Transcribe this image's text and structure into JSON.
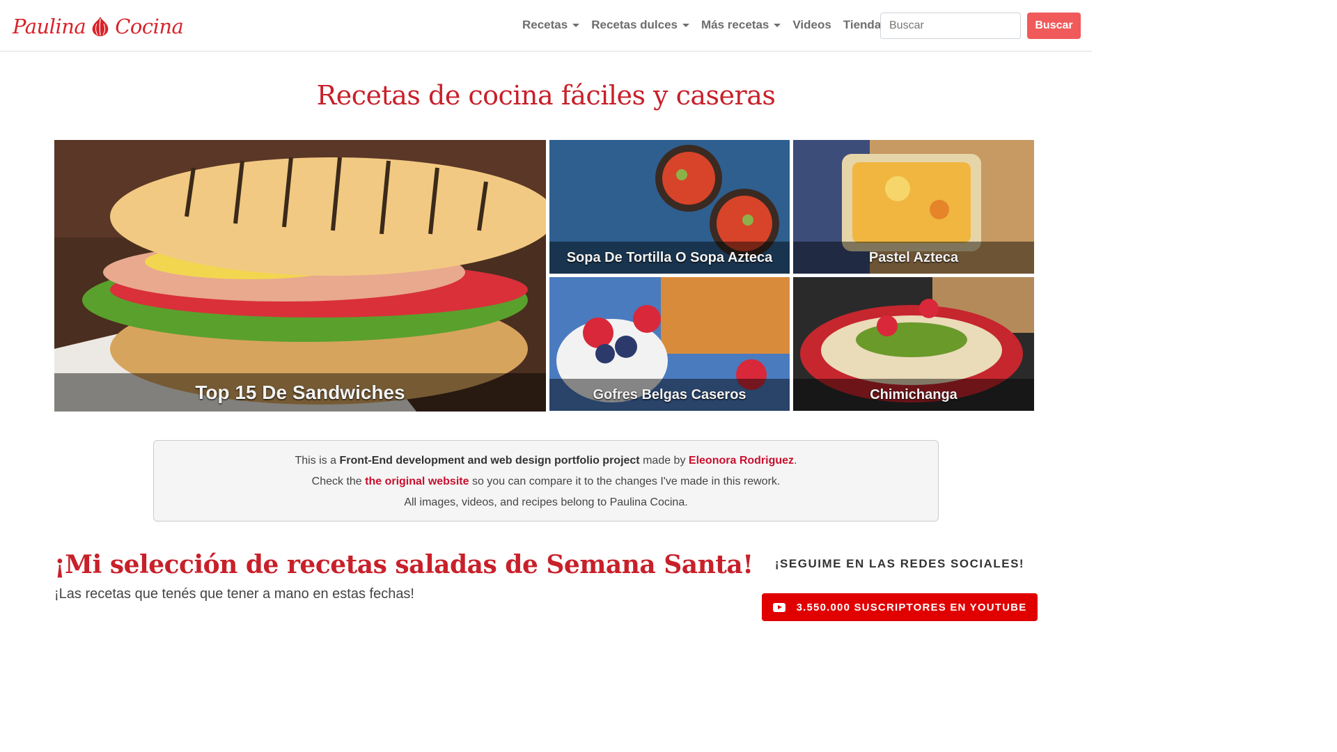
{
  "brand": {
    "logo_left": "Paulina",
    "logo_right": "Cocina"
  },
  "nav": {
    "items": [
      {
        "label": "Recetas",
        "dropdown": true
      },
      {
        "label": "Recetas dulces",
        "dropdown": true
      },
      {
        "label": "Más recetas",
        "dropdown": true
      },
      {
        "label": "Videos",
        "dropdown": false
      },
      {
        "label": "Tienda",
        "dropdown": true
      }
    ],
    "search_placeholder": "Buscar",
    "search_button": "Buscar"
  },
  "hero_title": "Recetas de cocina fáciles y caseras",
  "featured": [
    {
      "caption": "Top 15 De Sandwiches"
    },
    {
      "caption": "Sopa De Tortilla O Sopa Azteca"
    },
    {
      "caption": "Pastel Azteca"
    },
    {
      "caption": "Gofres Belgas Caseros"
    },
    {
      "caption": "Chimichanga"
    }
  ],
  "info": {
    "line1_pre": "This is a ",
    "line1_bold": "Front-End development and web design portfolio project",
    "line1_mid": " made by ",
    "line1_link": "Eleonora Rodriguez",
    "line1_end": ".",
    "line2_pre": "Check the ",
    "line2_link": "the original website",
    "line2_end": " so you can compare it to the changes I've made in this rework.",
    "line3": "All images, videos, and recipes belong to Paulina Cocina."
  },
  "section": {
    "title": "¡Mi selección de recetas saladas de Semana Santa!",
    "subtitle": "¡Las recetas que tenés que tener a mano en estas fechas!"
  },
  "social": {
    "title": "¡SEGUIME EN LAS REDES SOCIALES!",
    "youtube_label": "3.550.000 SUSCRIPTORES EN YOUTUBE"
  },
  "colors": {
    "brand_red": "#c8202a",
    "search_button": "#f05a5a",
    "youtube_red": "#e00000"
  }
}
